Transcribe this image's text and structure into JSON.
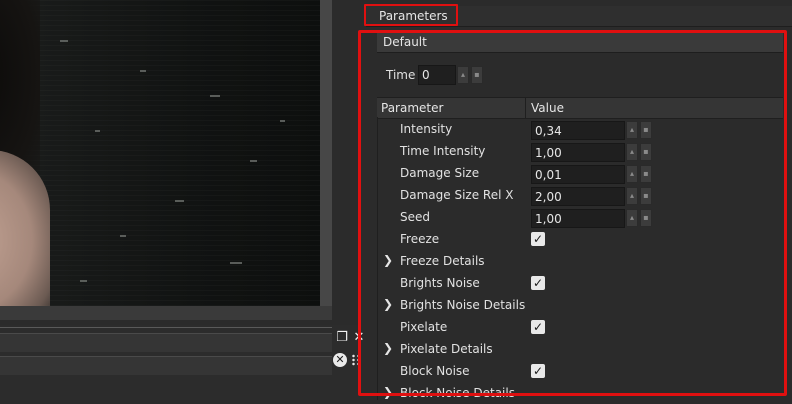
{
  "panel": {
    "title": "Parameters",
    "group": "Default",
    "time_label": "Time",
    "time_value": "0"
  },
  "table": {
    "col_parameter": "Parameter",
    "col_value": "Value"
  },
  "params": [
    {
      "label": "Intensity",
      "value": "0,34"
    },
    {
      "label": "Time Intensity",
      "value": "1,00"
    },
    {
      "label": "Damage Size",
      "value": "0,01"
    },
    {
      "label": "Damage Size Rel X",
      "value": "2,00"
    },
    {
      "label": "Seed",
      "value": "1,00"
    },
    {
      "label": "Freeze",
      "checked": true
    },
    {
      "label": "Freeze Details",
      "expandable": true
    },
    {
      "label": "Brights Noise",
      "checked": true
    },
    {
      "label": "Brights Noise Details",
      "expandable": true
    },
    {
      "label": "Pixelate",
      "checked": true
    },
    {
      "label": "Pixelate Details",
      "expandable": true
    },
    {
      "label": "Block Noise",
      "checked": true
    },
    {
      "label": "Block Noise Details",
      "expandable": true
    }
  ],
  "icons": {
    "float": "restore-window-icon",
    "close": "close-icon",
    "panel_close": "close-circle-icon",
    "grid": "grid-dots-icon",
    "expand": "chevron-right-icon",
    "check": "checkmark-icon",
    "reset": "reset-square-icon",
    "spinner": "spinner-icon"
  },
  "colors": {
    "highlight": "#e01010",
    "background": "#2b2b2b",
    "input_bg": "#1f1f1f"
  }
}
